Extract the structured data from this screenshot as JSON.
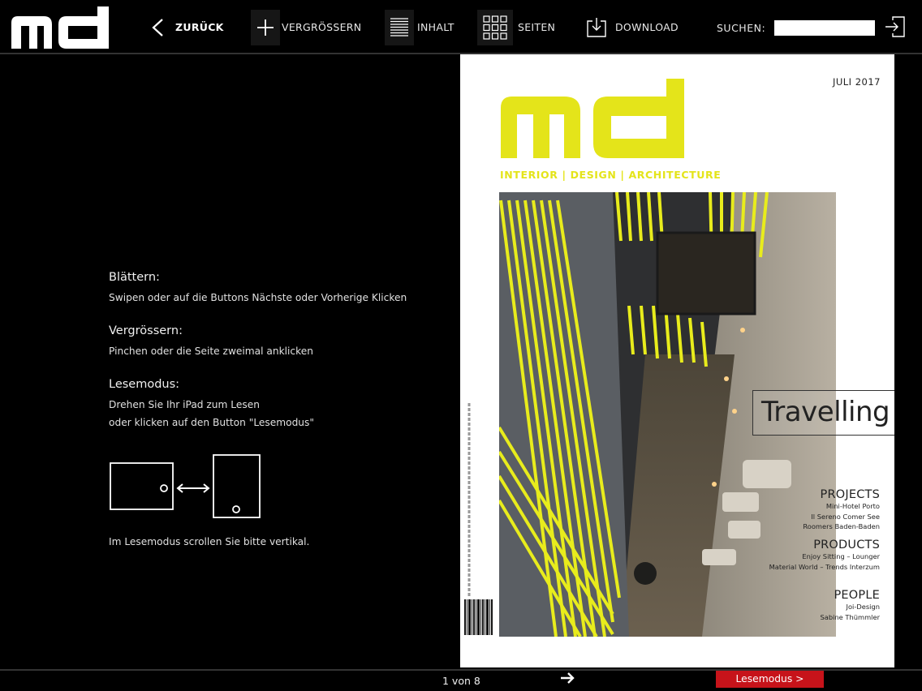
{
  "brand": {
    "logo_text": "md"
  },
  "toolbar": {
    "back_label": "ZURÜCK",
    "zoom_label": "VERGRÖSSERN",
    "toc_label": "INHALT",
    "pages_label": "SEITEN",
    "download_label": "DOWNLOAD",
    "search_label": "SUCHEN:",
    "search_value": ""
  },
  "help": {
    "sections": [
      {
        "title": "Blättern:",
        "lines": [
          "Swipen oder auf die Buttons Nächste oder Vorherige Klicken"
        ]
      },
      {
        "title": "Vergrössern:",
        "lines": [
          "Pinchen oder die Seite zweimal anklicken"
        ]
      },
      {
        "title": "Lesemodus:",
        "lines": [
          "Drehen Sie Ihr iPad zum Lesen",
          "oder klicken auf den Button \"Lesemodus\""
        ]
      }
    ],
    "scroll_note": "Im Lesemodus scrollen Sie bitte vertikal."
  },
  "cover": {
    "date": "JULI 2017",
    "logo_text": "md",
    "tagline": "INTERIOR | DESIGN | ARCHITECTURE",
    "feature": "Travelling",
    "sections": [
      {
        "heading": "PROJECTS",
        "items": [
          "Mini-Hotel Porto",
          "Il Sereno Comer See",
          "Roomers Baden-Baden"
        ]
      },
      {
        "heading": "PRODUCTS",
        "items": [
          "Enjoy Sitting – Lounger",
          "Material World – Trends Interzum"
        ]
      },
      {
        "heading": "PEOPLE",
        "items": [
          "Joi-Design",
          "Sabine Thümmler"
        ]
      }
    ],
    "accent_color": "#e4e41a"
  },
  "footer": {
    "page_info": "1 von 8",
    "lesemodus_label": "Lesemodus >",
    "lesemodus_color": "#c7131a"
  }
}
